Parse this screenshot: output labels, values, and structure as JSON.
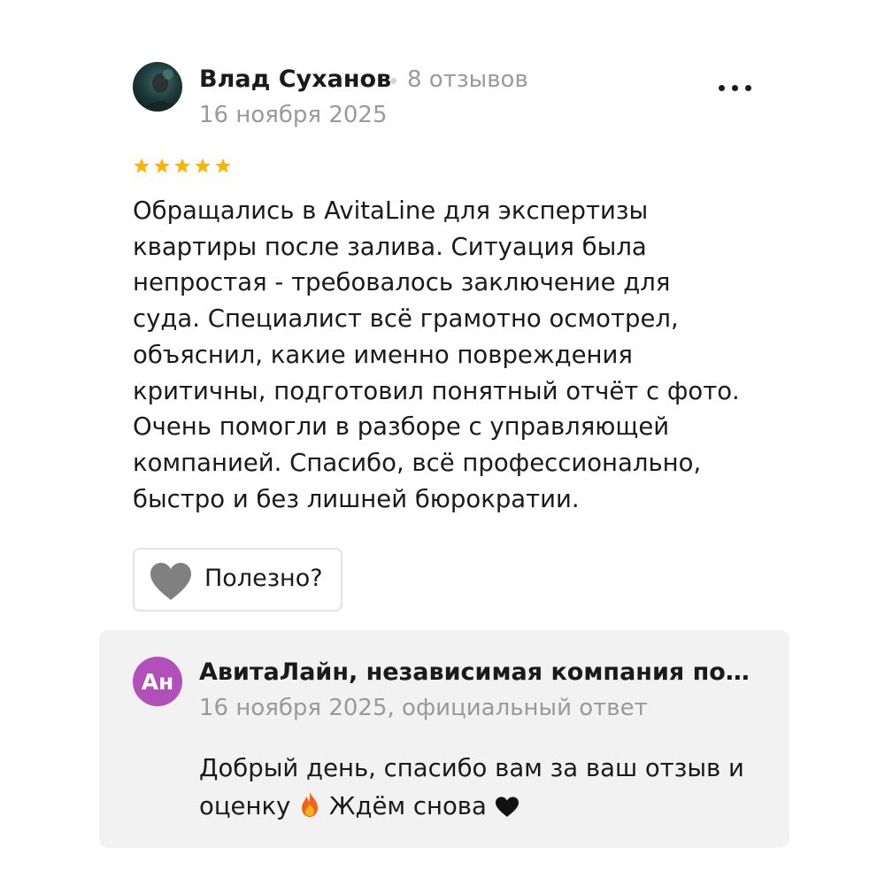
{
  "review": {
    "author": {
      "name": "Влад Суханов",
      "reviews_count": "8 отзывов"
    },
    "date": "16 ноября 2025",
    "rating": 5,
    "rating_max": 5,
    "text_lines": [
      "Обращались в AvitaLine для экспертизы",
      "квартиры после залива. Ситуация была",
      "непростая - требовалось заключение для",
      "суда. Специалист всё грамотно осмотрел,",
      "объяснил, какие именно повреждения",
      "критичны, подготовил понятный отчёт с фото.",
      "Очень помогли в разборе с управляющей",
      "компанией. Спасибо, всё профессионально,",
      "быстро и без лишней бюрократии."
    ],
    "helpful_label": "Полезно?"
  },
  "reply": {
    "avatar_initials": "Ан",
    "company_name": "АвитаЛайн, независимая компания по...",
    "meta": "16 ноября 2025, официальный ответ",
    "text_line1": "Добрый день, спасибо вам за ваш отзыв и",
    "text_line2_start": "оценку",
    "text_line2_mid": "Ждём снова",
    "emojis": [
      "fire-emoji",
      "black-heart-emoji"
    ]
  },
  "icons": {
    "more": "more-options-icon",
    "star": "star-icon",
    "helpful": "heart-icon"
  },
  "colors": {
    "star": "#ffb400",
    "muted_text": "#9a9a9a",
    "reply_background": "#f2f2f2",
    "reply_avatar": "#b050b8",
    "heart_icon": "#808080"
  }
}
